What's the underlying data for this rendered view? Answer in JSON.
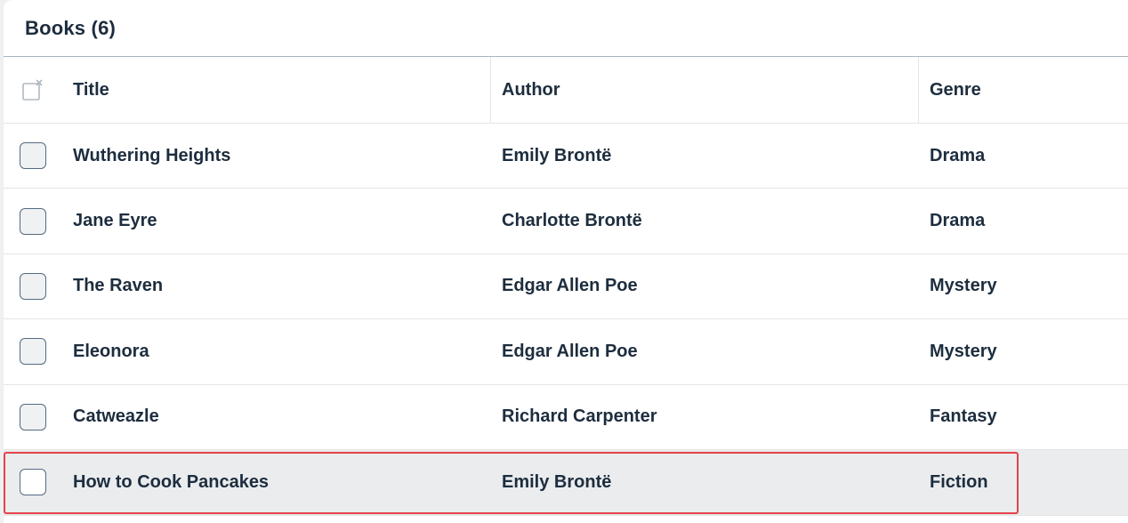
{
  "table": {
    "title": "Books (6)",
    "columns": {
      "title": "Title",
      "author": "Author",
      "genre": "Genre"
    },
    "rows": [
      {
        "title": "Wuthering Heights",
        "author": "Emily Brontë",
        "genre": "Drama"
      },
      {
        "title": "Jane Eyre",
        "author": "Charlotte Brontë",
        "genre": "Drama"
      },
      {
        "title": "The Raven",
        "author": "Edgar Allen Poe",
        "genre": "Mystery"
      },
      {
        "title": "Eleonora",
        "author": "Edgar Allen Poe",
        "genre": "Mystery"
      },
      {
        "title": "Catweazle",
        "author": "Richard Carpenter",
        "genre": "Fantasy"
      },
      {
        "title": "How to Cook Pancakes",
        "author": "Emily Brontë",
        "genre": "Fiction"
      }
    ]
  },
  "icons": {
    "clear_selection": "clear-selection-icon"
  },
  "colors": {
    "text": "#1d2d3e",
    "focus_outline": "#e4434a",
    "hover_row": "#eaecee",
    "checkbox_border": "#556b82"
  }
}
